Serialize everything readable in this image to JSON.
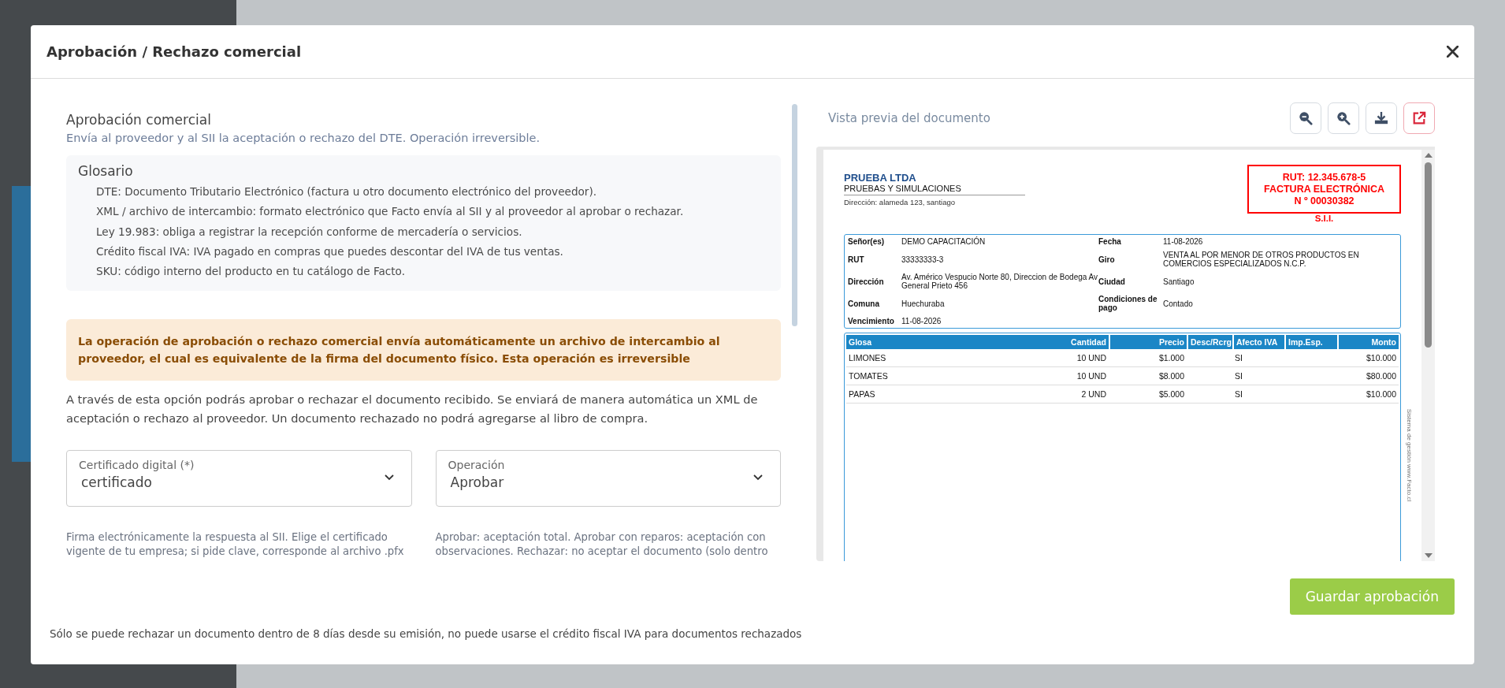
{
  "dialog": {
    "title": "Aprobación / Rechazo comercial"
  },
  "form": {
    "heading": "Aprobación comercial",
    "subtitle": "Envía al proveedor y al SII la aceptación o rechazo del DTE. Operación irreversible.",
    "glossary": {
      "title": "Glosario",
      "items": [
        "DTE: Documento Tributario Electrónico (factura u otro documento electrónico del proveedor).",
        "XML / archivo de intercambio: formato electrónico que Facto envía al SII y al proveedor al aprobar o rechazar.",
        "Ley 19.983: obliga a registrar la recepción conforme de mercadería o servicios.",
        "Crédito fiscal IVA: IVA pagado en compras que puedes descontar del IVA de tus ventas.",
        "SKU: código interno del producto en tu catálogo de Facto."
      ]
    },
    "warning": "La operación de aprobación o rechazo comercial envía automáticamente un archivo de intercambio al proveedor, el cual es equivalente de la firma del documento físico. Esta operación es irreversible",
    "description": "A través de esta opción podrás aprobar o rechazar el documento recibido. Se enviará de manera automática un XML de aceptación o rechazo al proveedor. Un documento rechazado no podrá agregarse al libro de compra.",
    "fields": [
      {
        "label": "Certificado digital (*)",
        "value": "certificado",
        "hint": "Firma electrónicamente la respuesta al SII. Elige el certificado vigente de tu empresa; si pide clave, corresponde al archivo .pfx"
      },
      {
        "label": "Operación",
        "value": "Aprobar",
        "hint": "Aprobar: aceptación total. Aprobar con reparos: aceptación con observaciones. Rechazar: no aceptar el documento (solo dentro"
      }
    ]
  },
  "preview": {
    "title": "Vista previa del documento",
    "document": {
      "company": {
        "name": "PRUEBA LTDA",
        "activity": "PRUEBAS Y SIMULACIONES",
        "address": "Dirección: alameda 123, santiago"
      },
      "stamp": {
        "rut": "RUT: 12.345.678-5",
        "type": "FACTURA ELECTRÓNICA",
        "number": "N º 00030382",
        "office": "S.I.I."
      },
      "info": [
        [
          {
            "label": "Señor(es)",
            "value": "DEMO CAPACITACIÓN"
          },
          {
            "label": "Fecha",
            "value": "11-08-2026"
          }
        ],
        [
          {
            "label": "RUT",
            "value": "33333333-3"
          },
          {
            "label": "Giro",
            "value": "VENTA AL POR MENOR DE OTROS PRODUCTOS EN COMERCIOS ESPECIALIZADOS N.C.P."
          }
        ],
        [
          {
            "label": "Dirección",
            "value": "Av. Américo Vespucio Norte 80, Direccion de Bodega Av General Prieto 456"
          },
          {
            "label": "Ciudad",
            "value": "Santiago"
          }
        ],
        [
          {
            "label": "Comuna",
            "value": "Huechuraba"
          },
          {
            "label": "Condiciones de pago",
            "value": "Contado"
          }
        ],
        [
          {
            "label": "Vencimiento",
            "value": "11-08-2026"
          }
        ]
      ],
      "columns": [
        "Glosa",
        "Cantidad",
        "Precio",
        "Desc/Rcrg",
        "Afecto IVA",
        "Imp.Esp.",
        "Monto"
      ],
      "rows": [
        [
          "LIMONES",
          "10 UND",
          "$1.000",
          "",
          "SI",
          "",
          "$10.000"
        ],
        [
          "TOMATES",
          "10 UND",
          "$8.000",
          "",
          "SI",
          "",
          "$80.000"
        ],
        [
          "PAPAS",
          "2 UND",
          "$5.000",
          "",
          "SI",
          "",
          "$10.000"
        ]
      ],
      "side_note": "Sistema de gestión www.Facto.cl"
    }
  },
  "save_button": "Guardar aprobación",
  "footer_note": "Sólo se puede rechazar un documento dentro de 8 días desde su emisión, no puede usarse el crédito fiscal IVA para documentos rechazados"
}
